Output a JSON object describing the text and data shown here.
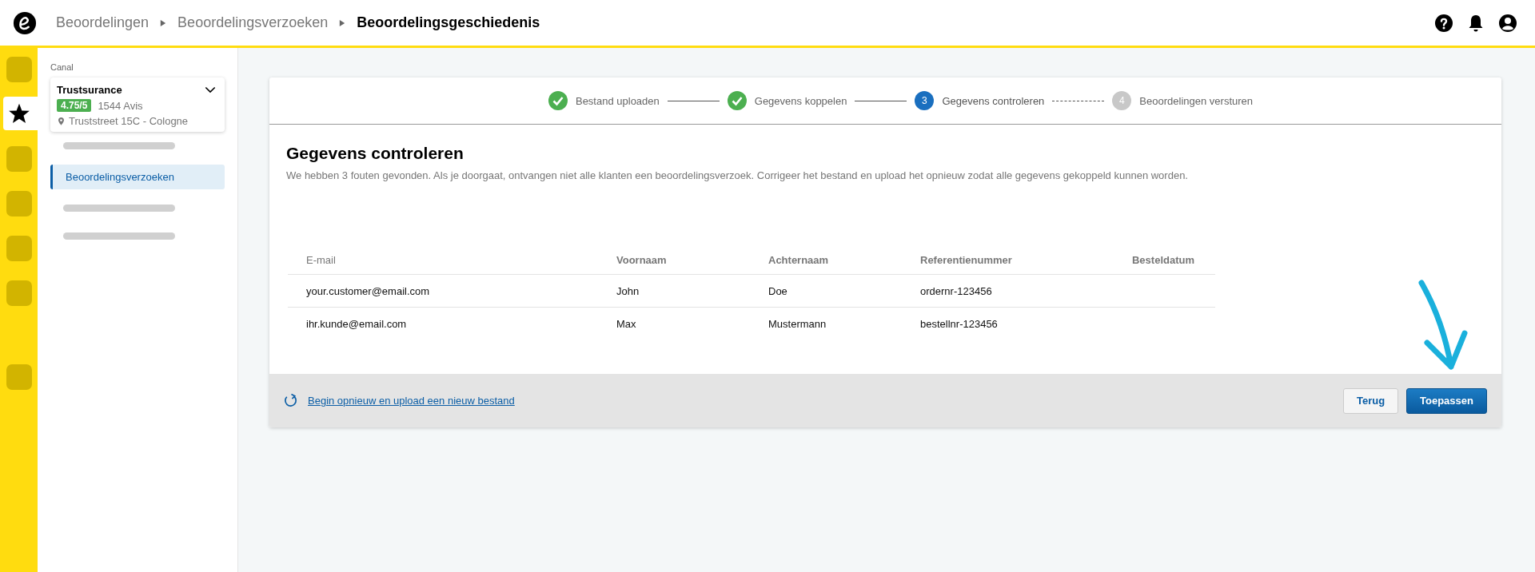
{
  "header": {
    "breadcrumbs": [
      {
        "label": "Beoordelingen",
        "current": false
      },
      {
        "label": "Beoordelingsverzoeken",
        "current": false
      },
      {
        "label": "Beoordelingsgeschiedenis",
        "current": true
      }
    ]
  },
  "rail": {
    "top": [
      {
        "kind": "blank",
        "selected": false
      },
      {
        "kind": "star",
        "selected": true
      },
      {
        "kind": "blank",
        "selected": false
      },
      {
        "kind": "blank",
        "selected": false
      },
      {
        "kind": "blank",
        "selected": false
      },
      {
        "kind": "blank",
        "selected": false
      }
    ],
    "bottom": [
      {
        "kind": "blank",
        "selected": false
      }
    ]
  },
  "sidebar": {
    "label": "Canal",
    "shop": {
      "name": "Trustsurance",
      "rating": "4.75/5",
      "reviews": "1544 Avis",
      "address": "Truststreet 15C - Cologne"
    },
    "items": [
      {
        "kind": "placeholder",
        "selected": false
      },
      {
        "kind": "link",
        "label": "Beoordelingsverzoeken",
        "selected": true
      },
      {
        "kind": "placeholder",
        "selected": false
      },
      {
        "kind": "placeholder",
        "selected": false
      }
    ]
  },
  "steps": [
    {
      "completed": true,
      "selected": false,
      "label": "Bestand uploaden"
    },
    {
      "completed": true,
      "selected": false,
      "label": "Gegevens koppelen"
    },
    {
      "completed": false,
      "selected": true,
      "number": "3",
      "label": "Gegevens controleren"
    },
    {
      "completed": false,
      "selected": false,
      "number": "4",
      "label": "Beoordelingen versturen"
    }
  ],
  "content": {
    "title": "Gegevens controleren",
    "description": "We hebben 3 fouten gevonden. Als je doorgaat, ontvangen niet alle klanten een beoordelingsverzoek. Corrigeer het bestand en upload het opnieuw zodat alle gegevens gekoppeld kunnen worden."
  },
  "table": {
    "columns": [
      "E-mail",
      "Voornaam",
      "Achternaam",
      "Referentienummer",
      "Besteldatum"
    ],
    "rows": [
      [
        "your.customer@email.com",
        "John",
        "Doe",
        "ordernr-123456"
      ],
      [
        "ihr.kunde@email.com",
        "Max",
        "Mustermann",
        "bestellnr-123456"
      ]
    ]
  },
  "footer": {
    "link": "Begin opnieuw en upload een nieuw bestand",
    "buttons": [
      {
        "kind": "secondary",
        "label": "Terug"
      },
      {
        "kind": "primary",
        "label": "Toepassen"
      }
    ]
  }
}
